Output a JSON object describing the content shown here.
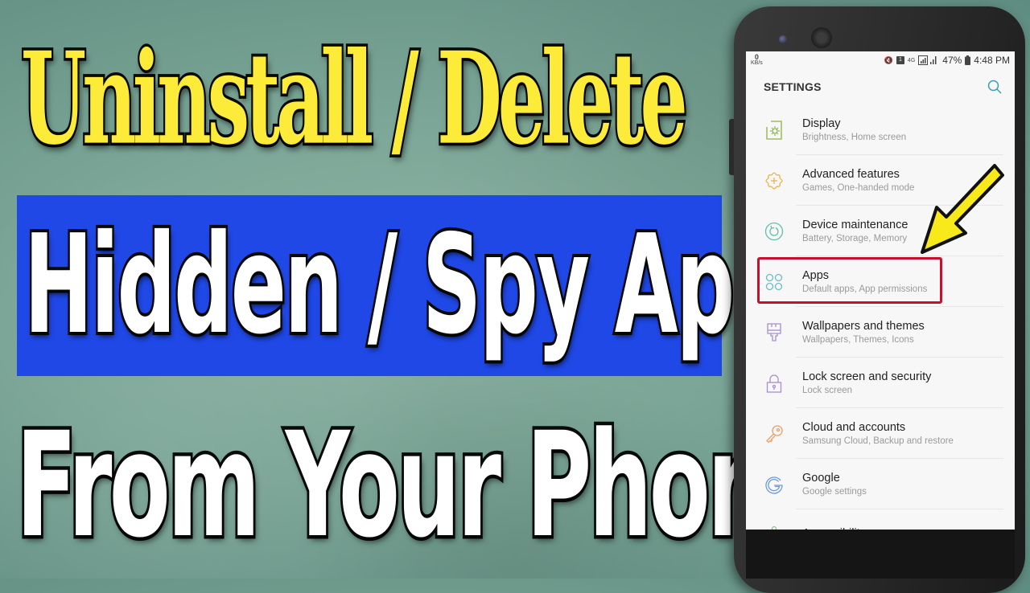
{
  "thumbnail": {
    "headline_line1": "Uninstall / Delete",
    "headline_line2": "Hidden / Spy Apps",
    "headline_line3": "From Your Phone",
    "colors": {
      "line1_fill": "#fdeb3a",
      "banner_bg": "#1f48e6",
      "text_white": "#ffffff",
      "outline": "#0a0a0a",
      "highlight_box": "#c8102e",
      "arrow": "#f8ea1a"
    }
  },
  "phone": {
    "status_bar": {
      "net_speed_value": "0",
      "net_speed_unit": "KB/s",
      "mute_icon": "vibrate-mute-icon",
      "sim_label": "1",
      "network_type": "4G",
      "battery_percent": "47%",
      "time": "4:48 PM"
    },
    "settings": {
      "title": "SETTINGS",
      "search_icon": "search-icon",
      "items": [
        {
          "label": "Display",
          "subtitle": "Brightness, Home screen",
          "icon": "display-brightness-icon",
          "icon_color": "#8bb34a"
        },
        {
          "label": "Advanced features",
          "subtitle": "Games, One-handed mode",
          "icon": "gear-plus-icon",
          "icon_color": "#e8b44c"
        },
        {
          "label": "Device maintenance",
          "subtitle": "Battery, Storage, Memory",
          "icon": "refresh-circle-icon",
          "icon_color": "#5cc0a8"
        },
        {
          "label": "Apps",
          "subtitle": "Default apps, App permissions",
          "icon": "apps-grid-icon",
          "icon_color": "#6cbcc8"
        },
        {
          "label": "Wallpapers and themes",
          "subtitle": "Wallpapers, Themes, Icons",
          "icon": "paintbrush-icon",
          "icon_color": "#a88ed0"
        },
        {
          "label": "Lock screen and security",
          "subtitle": "Lock screen",
          "icon": "lock-icon",
          "icon_color": "#a88ed0"
        },
        {
          "label": "Cloud and accounts",
          "subtitle": "Samsung Cloud, Backup and restore",
          "icon": "key-icon",
          "icon_color": "#e8a068"
        },
        {
          "label": "Google",
          "subtitle": "Google settings",
          "icon": "google-g-icon",
          "icon_color": "#6c9ad8"
        },
        {
          "label": "Accessibility",
          "subtitle": "",
          "icon": "accessibility-icon",
          "icon_color": "#8cc890"
        }
      ]
    }
  }
}
